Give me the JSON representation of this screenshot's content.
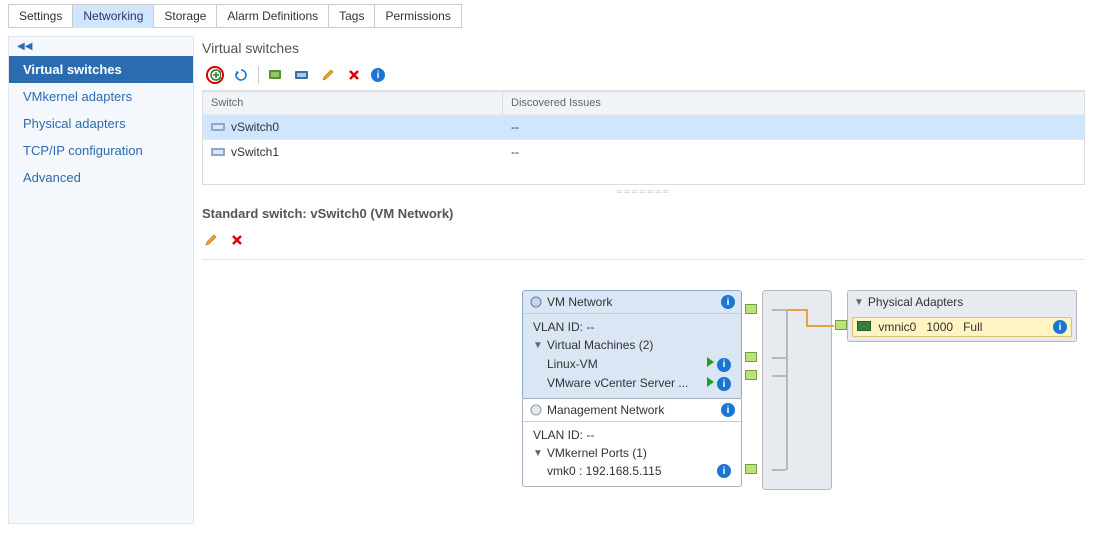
{
  "tabs": [
    "Settings",
    "Networking",
    "Storage",
    "Alarm Definitions",
    "Tags",
    "Permissions"
  ],
  "activeTab": "Networking",
  "sidebar": {
    "items": [
      "Virtual switches",
      "VMkernel adapters",
      "Physical adapters",
      "TCP/IP configuration",
      "Advanced"
    ],
    "active": "Virtual switches"
  },
  "section": {
    "title": "Virtual switches",
    "columns": [
      "Switch",
      "Discovered Issues"
    ],
    "rows": [
      {
        "name": "vSwitch0",
        "issues": "--",
        "selected": true
      },
      {
        "name": "vSwitch1",
        "issues": "--",
        "selected": false
      }
    ]
  },
  "detail": {
    "title": "Standard switch: vSwitch0 (VM Network)"
  },
  "vmNetwork": {
    "title": "VM Network",
    "vlan": "VLAN ID: --",
    "group": "Virtual Machines (2)",
    "vms": [
      "Linux-VM",
      "VMware vCenter Server ..."
    ]
  },
  "mgmtNetwork": {
    "title": "Management Network",
    "vlan": "VLAN ID: --",
    "group": "VMkernel Ports (1)",
    "port": "vmk0 : 192.168.5.115"
  },
  "physAdapters": {
    "title": "Physical Adapters",
    "nic": {
      "name": "vmnic0",
      "speed": "1000",
      "duplex": "Full"
    }
  }
}
